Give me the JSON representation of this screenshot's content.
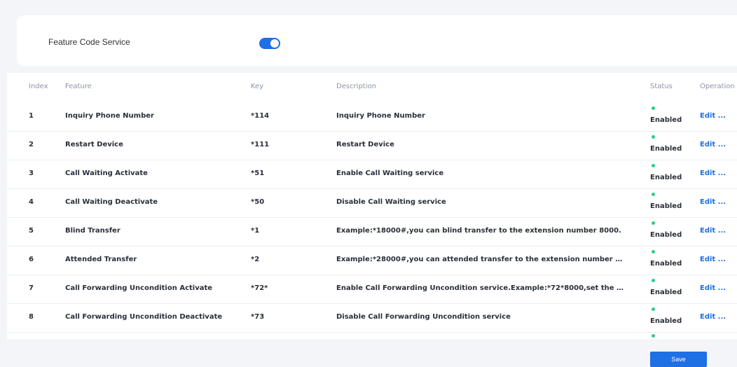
{
  "service": {
    "label": "Feature Code Service",
    "enabled": true
  },
  "table": {
    "headers": {
      "index": "Index",
      "feature": "Feature",
      "key": "Key",
      "description": "Description",
      "status": "Status",
      "operation": "Operation"
    },
    "rows": [
      {
        "index": "1",
        "feature": "Inquiry Phone Number",
        "key": "*114",
        "description": "Inquiry Phone Number",
        "status": "Enabled",
        "operation": "Edit ..."
      },
      {
        "index": "2",
        "feature": "Restart Device",
        "key": "*111",
        "description": "Restart Device",
        "status": "Enabled",
        "operation": "Edit ..."
      },
      {
        "index": "3",
        "feature": "Call Waiting Activate",
        "key": "*51",
        "description": "Enable Call Waiting service",
        "status": "Enabled",
        "operation": "Edit ..."
      },
      {
        "index": "4",
        "feature": "Call Waiting Deactivate",
        "key": "*50",
        "description": "Disable Call Waiting service",
        "status": "Enabled",
        "operation": "Edit ..."
      },
      {
        "index": "5",
        "feature": "Blind Transfer",
        "key": "*1",
        "description": "Example:*18000#,you can blind transfer to the extension number 8000.",
        "status": "Enabled",
        "operation": "Edit ..."
      },
      {
        "index": "6",
        "feature": "Attended Transfer",
        "key": "*2",
        "description": "Example:*28000#,you can attended transfer to the extension number 80...",
        "status": "Enabled",
        "operation": "Edit ..."
      },
      {
        "index": "7",
        "feature": "Call Forwarding Uncondition Activate",
        "key": "*72*",
        "description": "Enable Call Forwarding Uncondition service.Example:*72*8000,set the cal...",
        "status": "Enabled",
        "operation": "Edit ..."
      },
      {
        "index": "8",
        "feature": "Call Forwarding Uncondition Deactivate",
        "key": "*73",
        "description": "Disable Call Forwarding Uncondition service",
        "status": "Enabled",
        "operation": "Edit ..."
      }
    ]
  },
  "save_label": "Save",
  "colors": {
    "accent": "#1f6fe5",
    "status_enabled": "#2ecc8a"
  }
}
